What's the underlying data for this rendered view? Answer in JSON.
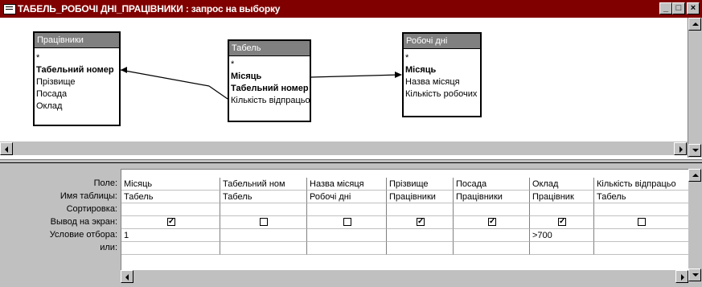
{
  "window": {
    "title": "ТАБЕЛЬ_РОБОЧІ ДНІ_ПРАЦІВНИКИ : запрос на выборку",
    "minimize": "_",
    "maximize": "□",
    "close": "×"
  },
  "tables": [
    {
      "title": "Працівники",
      "fields": [
        {
          "label": "*",
          "bold": false
        },
        {
          "label": "Табельний номер",
          "bold": true
        },
        {
          "label": "Прізвище",
          "bold": false
        },
        {
          "label": "Посада",
          "bold": false
        },
        {
          "label": "Оклад",
          "bold": false
        }
      ]
    },
    {
      "title": "Табель",
      "fields": [
        {
          "label": "*",
          "bold": false
        },
        {
          "label": "Місяць",
          "bold": true
        },
        {
          "label": "Табельний номер",
          "bold": true
        },
        {
          "label": "Кількість відпрацьованих",
          "bold": false
        }
      ]
    },
    {
      "title": "Робочі дні",
      "fields": [
        {
          "label": "*",
          "bold": false
        },
        {
          "label": "Місяць",
          "bold": true
        },
        {
          "label": "Назва місяця",
          "bold": false
        },
        {
          "label": "Кількість робочих",
          "bold": false
        }
      ]
    }
  ],
  "grid": {
    "row_labels": [
      "Поле:",
      "Имя таблицы:",
      "Сортировка:",
      "Вывод на экран:",
      "Условие отбора:",
      "или:"
    ],
    "columns": [
      {
        "field": "Місяць",
        "table": "Табель",
        "sort": "",
        "show": true,
        "criteria": "1",
        "or": ""
      },
      {
        "field": "Табельний ном",
        "table": "Табель",
        "sort": "",
        "show": false,
        "criteria": "",
        "or": ""
      },
      {
        "field": "Назва місяця",
        "table": "Робочі дні",
        "sort": "",
        "show": false,
        "criteria": "",
        "or": ""
      },
      {
        "field": "Прізвище",
        "table": "Працівники",
        "sort": "",
        "show": true,
        "criteria": "",
        "or": ""
      },
      {
        "field": "Посада",
        "table": "Працівники",
        "sort": "",
        "show": true,
        "criteria": "",
        "or": ""
      },
      {
        "field": "Оклад",
        "table": "Працівник",
        "sort": "",
        "show": true,
        "criteria": ">700",
        "or": ""
      },
      {
        "field": "Кількість відпрацьо",
        "table": "Табель",
        "sort": "",
        "show": false,
        "criteria": "",
        "or": ""
      }
    ]
  },
  "check_glyph": "✓"
}
